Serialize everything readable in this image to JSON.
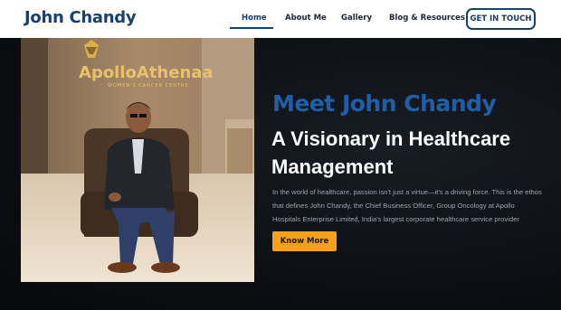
{
  "header": {
    "brand": "John Chandy",
    "nav": [
      "Home",
      "About Me",
      "Gallery",
      "Blog & Resources"
    ],
    "active_nav": "Home",
    "cta_label": "GET IN TOUCH"
  },
  "hero": {
    "heading": "Meet John Chandy",
    "subheading": "A Visionary in Healthcare Management",
    "description": "In the world of healthcare, passion isn't just a virtue—it's a driving force. This is the ethos that defines John Chandy, the Chief Business Officer, Group Oncology at Apollo Hospitals Enterprise Limited, India's largest corporate healthcare service provider",
    "button_label": "Know More"
  },
  "photo": {
    "sign_text": "ApolloAthenaa",
    "sign_subtext": "WOMEN'S CANCER CENTRE"
  },
  "colors": {
    "brand_blue": "#16406e",
    "heading_blue": "#1f5fa8",
    "accent_orange": "#f5a018",
    "background": "#0a0c0f"
  },
  "icons": [
    "apollo-logo-icon"
  ]
}
